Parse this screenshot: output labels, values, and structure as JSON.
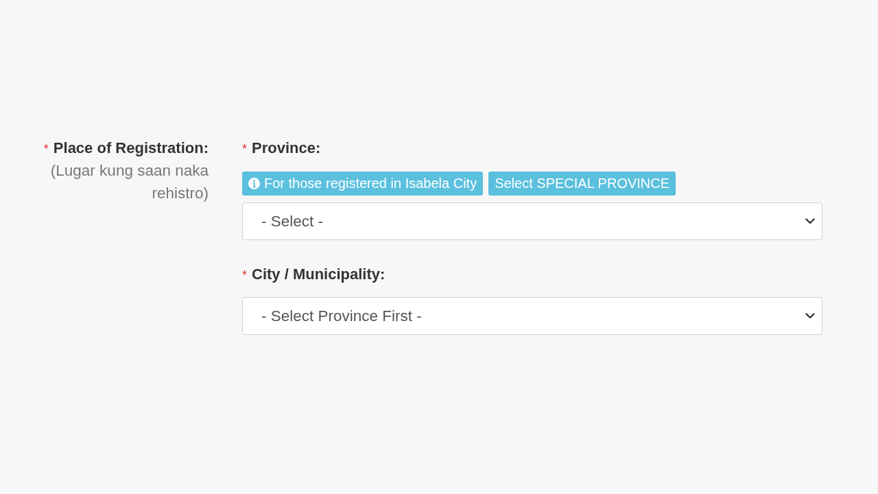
{
  "registration": {
    "label": {
      "required_mark": "*",
      "text": "Place of Registration:"
    },
    "hint": "(Lugar kung saan naka rehistro)",
    "fields": [
      {
        "kind": "select",
        "required_mark": "*",
        "label": "Province:",
        "badges": [
          {
            "kind": "info",
            "text": "For those registered in Isabela City"
          },
          {
            "kind": "action",
            "text": "Select SPECIAL PROVINCE"
          }
        ],
        "value": "- Select -"
      },
      {
        "kind": "select",
        "required_mark": "*",
        "label": "City / Municipality:",
        "value": "- Select Province First -"
      }
    ]
  }
}
